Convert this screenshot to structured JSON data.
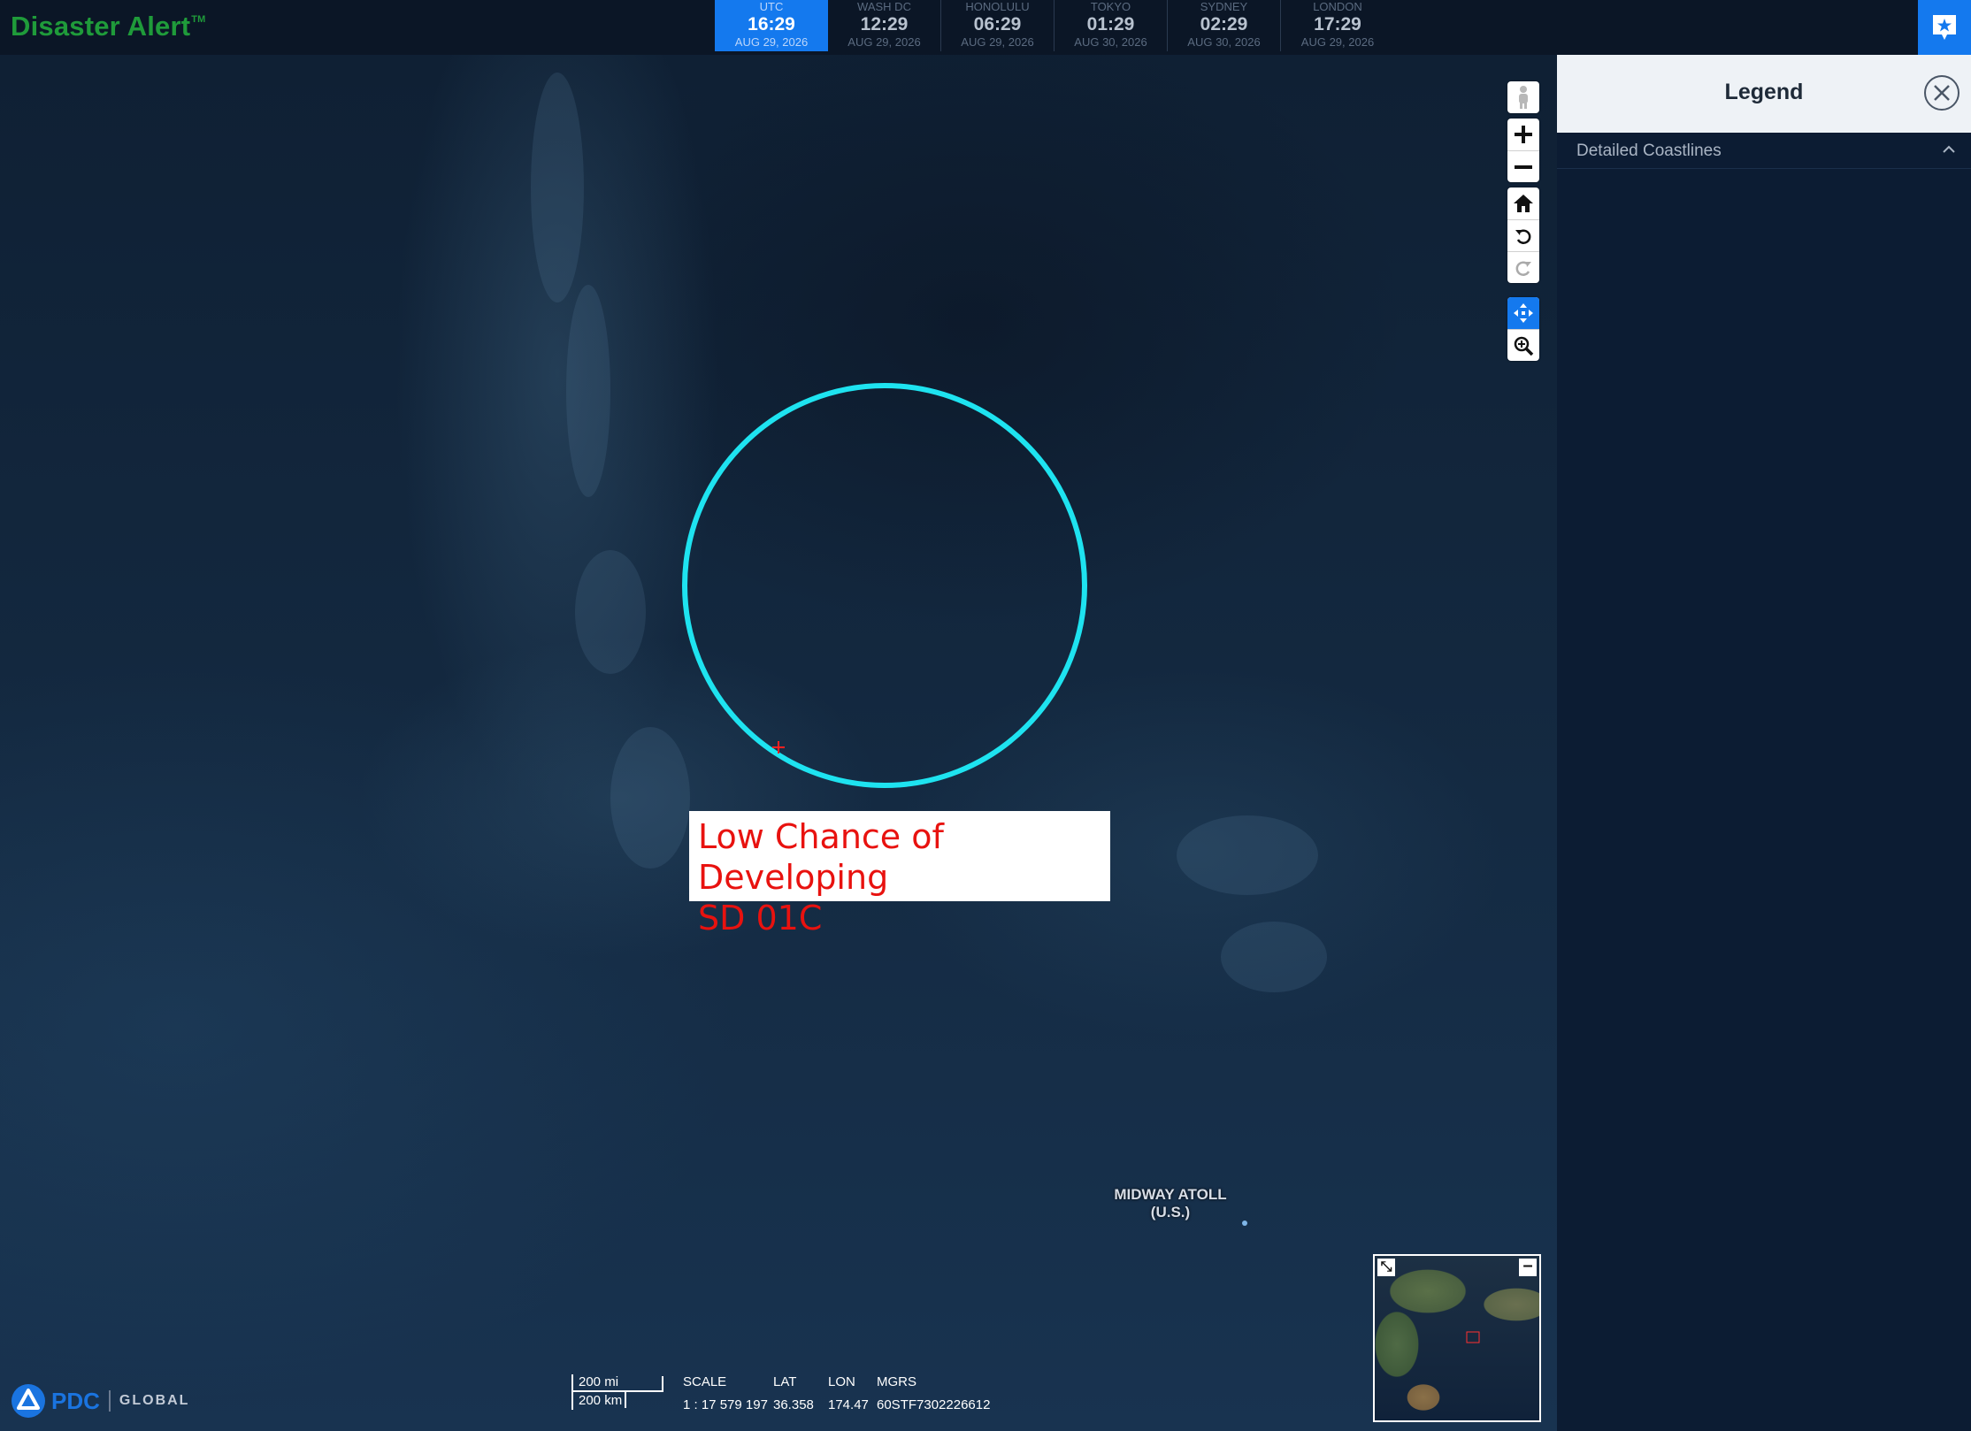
{
  "app": {
    "title": "Disaster Alert",
    "trademark": "TM"
  },
  "clocks": [
    {
      "zone": "UTC",
      "time": "16:29",
      "date": "AUG 29, 2026",
      "active": true
    },
    {
      "zone": "WASH DC",
      "time": "12:29",
      "date": "AUG 29, 2026",
      "active": false
    },
    {
      "zone": "HONOLULU",
      "time": "06:29",
      "date": "AUG 29, 2026",
      "active": false
    },
    {
      "zone": "TOKYO",
      "time": "01:29",
      "date": "AUG 30, 2026",
      "active": false
    },
    {
      "zone": "SYDNEY",
      "time": "02:29",
      "date": "AUG 30, 2026",
      "active": false
    },
    {
      "zone": "LONDON",
      "time": "17:29",
      "date": "AUG 29, 2026",
      "active": false
    }
  ],
  "header": {
    "alert_icon": "alert-star-icon"
  },
  "map": {
    "storm": {
      "label_line1": "Low Chance of Developing",
      "label_line2": "SD 01C",
      "ring_color": "#1ee3f0",
      "marker_color": "#ff2020"
    },
    "place_label_line1": "MIDWAY ATOLL",
    "place_label_line2": "(U.S.)"
  },
  "controls": {
    "pegman": "person-icon",
    "zoom_in": "plus-icon",
    "zoom_out": "minus-icon",
    "home": "home-icon",
    "rotate_left": "rotate-left-icon",
    "rotate_right": "rotate-right-icon",
    "pan": "pan-arrows-icon",
    "zoom_box": "magnifier-plus-icon"
  },
  "scale": {
    "mi_label": "200 mi",
    "km_label": "200 km"
  },
  "readout": {
    "scale_label": "SCALE",
    "scale_value": "1 : 17 579 197",
    "lat_label": "LAT",
    "lat_value": "36.358",
    "lon_label": "LON",
    "lon_value": "174.47",
    "mgrs_label": "MGRS",
    "mgrs_value": "60STF7302226612"
  },
  "footer": {
    "logo_text": "PDC",
    "logo_sub": "GLOBAL"
  },
  "legend": {
    "title": "Legend",
    "rows": [
      {
        "label": "Detailed Coastlines",
        "expanded": true
      }
    ]
  },
  "colors": {
    "brand_green": "#1f9b3a",
    "accent_blue": "#1479ee",
    "panel_bg": "#0c1c33"
  }
}
